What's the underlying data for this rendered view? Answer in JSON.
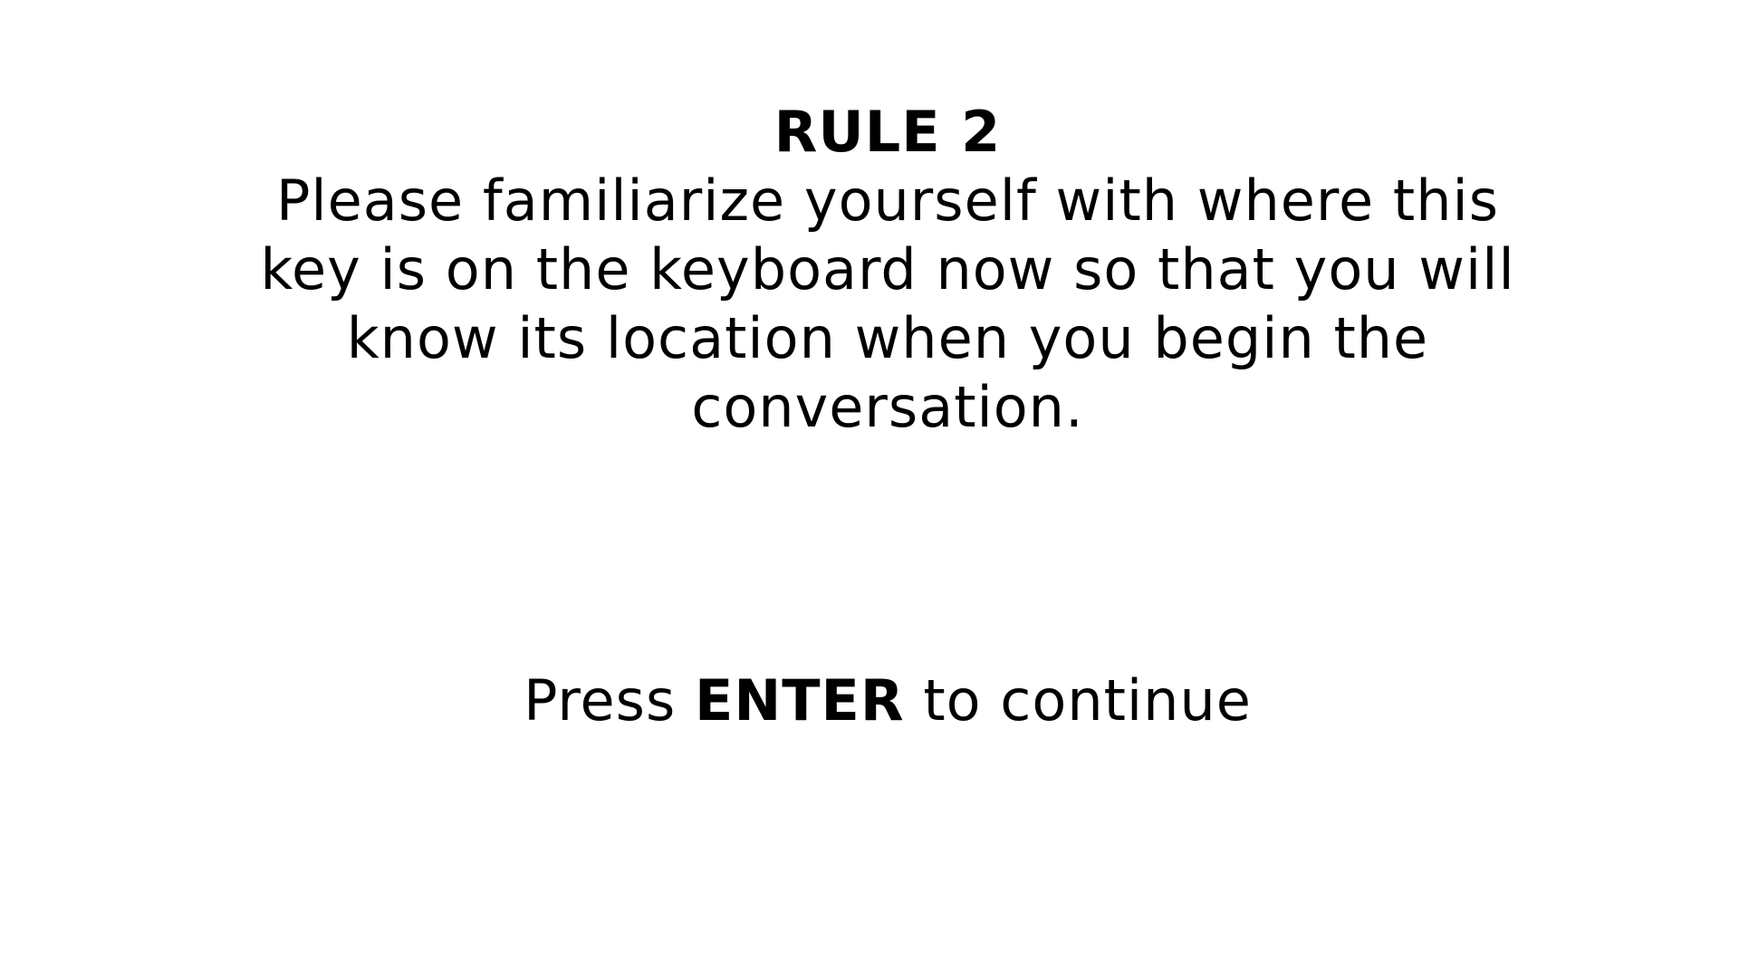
{
  "rule": {
    "title": "RULE 2",
    "lines": [
      "Please familiarize yourself with where this",
      "key is on the keyboard now so that you will",
      "know its location when you begin the",
      "conversation."
    ]
  },
  "prompt": {
    "prefix": "Press ",
    "key": "ENTER",
    "suffix": " to continue"
  },
  "colors": {
    "background": "#ffffff",
    "text": "#000000"
  }
}
